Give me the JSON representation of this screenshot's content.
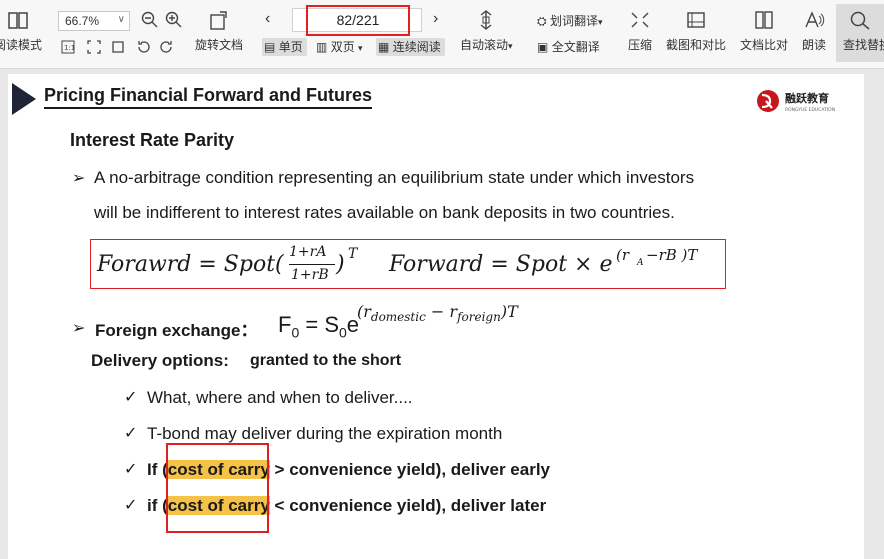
{
  "toolbar": {
    "read_mode": "阅读模式",
    "zoom": "66.7%",
    "rotate": "旋转文档",
    "single": "单页",
    "double": "双页",
    "continuous": "连续阅读",
    "page_indicator": "82/221",
    "auto_scroll": "自动滚动",
    "word_translate": "划词翻译",
    "full_translate": "全文翻译",
    "compress": "压缩",
    "screenshot_compare": "截图和对比",
    "doc_compare": "文档比对",
    "read_aloud": "朗读",
    "find_replace": "查找替换"
  },
  "slide": {
    "title": "Pricing Financial Forward and Futures",
    "logo_text": "融跃教育",
    "logo_sub": "RONGYUE EDUCATION",
    "heading": "Interest Rate Parity",
    "bullet1_line1": "A no-arbitrage condition representing an equilibrium state under which investors",
    "bullet1_line2": "will be  indifferent to interest rates available on bank deposits in two countries.",
    "formula_left": "Forawrd = Spot(",
    "formula_num": "1+rA",
    "formula_den": "1+rB",
    "formula_exp": ")",
    "formula_T": "T",
    "formula_right": "Forward = Spot × e",
    "formula_right_exp": "(r",
    "formula_right_sub": "A",
    "formula_right_rest": "−rB )T",
    "fx_label": "Foreign exchange：",
    "fx_formula": "F",
    "fx_0": "0",
    "fx_eq": " = S",
    "fx_s0": "0",
    "fx_e": "e",
    "fx_exp": "(r",
    "fx_dom": "domestic",
    "fx_minus": " − r",
    "fx_for": "foreign",
    "fx_T": ")T",
    "delivery_label": "Delivery options:",
    "delivery_value": "granted to the short",
    "check1": "What, where and when to deliver....",
    "check2": "T-bond may deliver during the expiration month",
    "check3_pre": "If (",
    "check3_hl": "cost of carry",
    "check3_post": " > convenience yield), deliver early",
    "check4_pre": "if (",
    "check4_hl": "cost of carry",
    "check4_post": " < convenience yield), deliver later"
  }
}
